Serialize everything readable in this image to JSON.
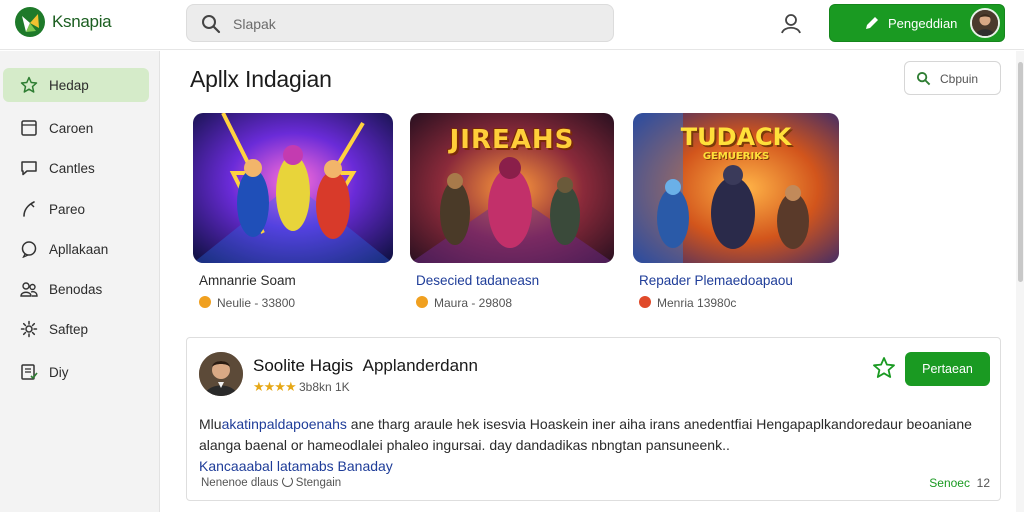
{
  "app": {
    "name": "Ksnapia"
  },
  "search": {
    "placeholder": "Slapak"
  },
  "header": {
    "primary_button": "Pengeddian"
  },
  "sidebar": {
    "items": [
      {
        "label": "Hedap",
        "icon": "star-icon",
        "active": true
      },
      {
        "label": "Caroen",
        "icon": "tablet-icon"
      },
      {
        "label": "Cantles",
        "icon": "chat-icon"
      },
      {
        "label": "Pareo",
        "icon": "pen-icon"
      },
      {
        "label": "Apllakaan",
        "icon": "comment-icon"
      },
      {
        "label": "Benodas",
        "icon": "people-icon"
      },
      {
        "label": "Saftep",
        "icon": "settings-icon"
      },
      {
        "label": "Diy",
        "icon": "document-icon"
      }
    ]
  },
  "main": {
    "title": "Apllx Indagian",
    "sort_button": "Cbpuin",
    "cards": [
      {
        "title": "Amnanrie Soam",
        "meta": "Neulie - 33800",
        "badge_color": "#f0a020",
        "banner": ""
      },
      {
        "title": "Desecied tadaneasn",
        "meta": "Maura - 29808",
        "badge_color": "#f0a020",
        "banner": "JIREAHS"
      },
      {
        "title": "Repader Plemaedoapaou",
        "meta": "Menria 13980c",
        "badge_color": "#e04a2a",
        "banner": "TUDACK",
        "banner_sub": "GEMUERIKS"
      }
    ]
  },
  "review": {
    "name": "Soolite Hagis",
    "name_suffix": "Applanderdann",
    "stars": "★★★★",
    "stars_text": "3b8kn 1K",
    "action_button": "Pertaean",
    "body_start": "Mlu",
    "body_link": "akatinpaldapoenahs",
    "body_mid": " ane tharg araule hek isesvia Hoaskein iner aiha irans anedentfiai Hengapaplkandoredaur beoaniane alanga baenal or hameodlalei phaleo ingursai. day dandadikas nbngtan pansuneenk..",
    "body_link2": "Kancaaabal latamabs Banaday",
    "footer": "Nenenoe dlaus",
    "footer_source": "Stengain",
    "count_label": "Senoec",
    "count": "12"
  },
  "colors": {
    "accent": "#1a9a22",
    "active_nav": "#d5ebc9",
    "link": "#1f3d99"
  }
}
